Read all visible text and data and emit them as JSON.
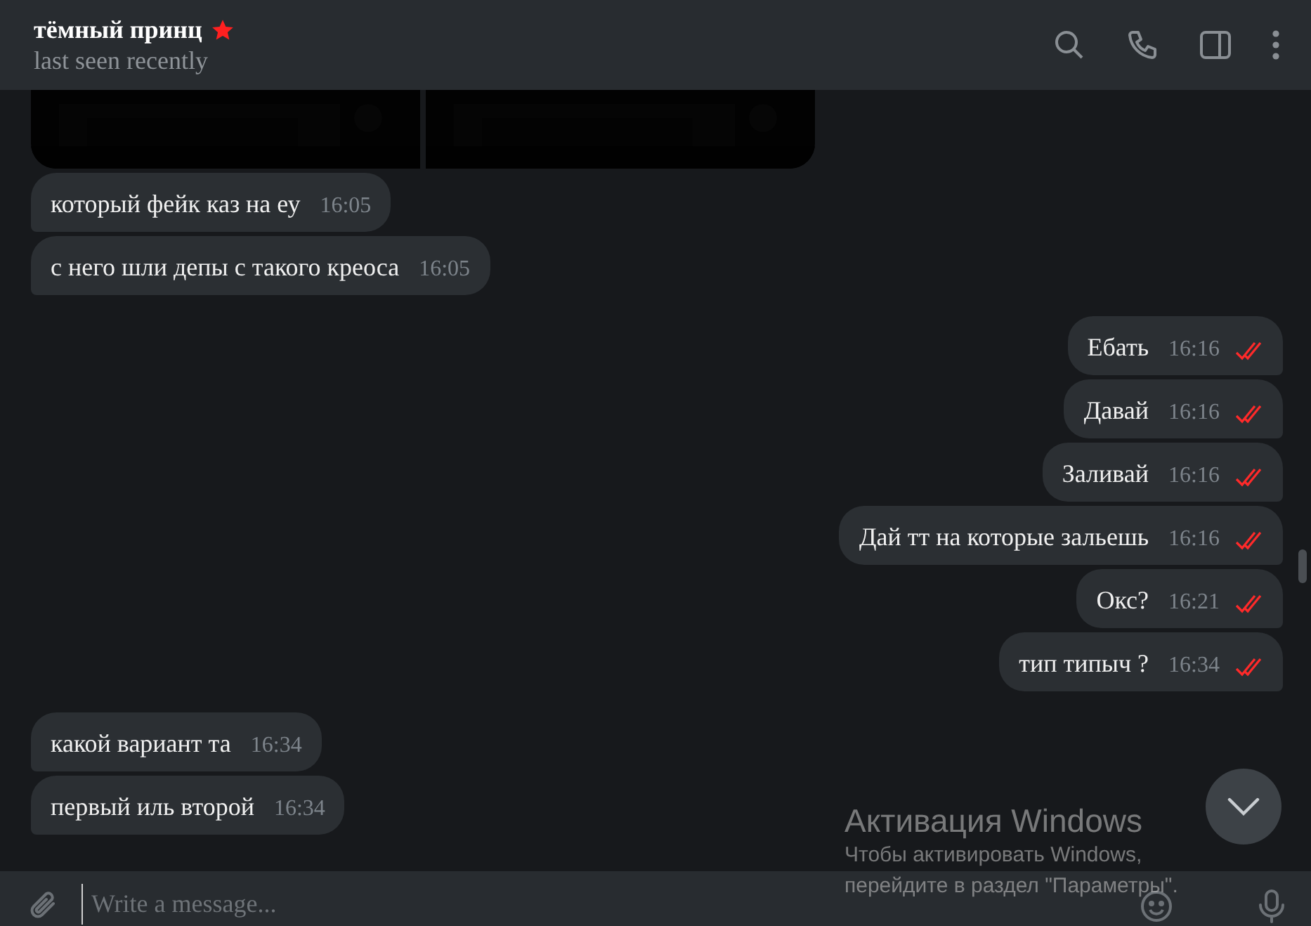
{
  "header": {
    "name": "тёмный принц",
    "verified_star": true,
    "status": "last seen recently"
  },
  "messages": [
    {
      "kind": "album"
    },
    {
      "kind": "incoming",
      "text": "который фейк каз на еу",
      "time": "16:05"
    },
    {
      "kind": "incoming",
      "text": "с него шли депы с такого креоса",
      "time": "16:05"
    },
    {
      "kind": "outgoing",
      "text": "Ебать",
      "time": "16:16",
      "read": true
    },
    {
      "kind": "outgoing",
      "text": "Давай",
      "time": "16:16",
      "read": true
    },
    {
      "kind": "outgoing",
      "text": "Заливай",
      "time": "16:16",
      "read": true
    },
    {
      "kind": "outgoing",
      "text": "Дай тт на которые зальешь",
      "time": "16:16",
      "read": true
    },
    {
      "kind": "outgoing",
      "text": "Окс?",
      "time": "16:21",
      "read": true
    },
    {
      "kind": "outgoing",
      "text": "тип типыч ?",
      "time": "16:34",
      "read": true
    },
    {
      "kind": "incoming",
      "text": "какой вариант та",
      "time": "16:34"
    },
    {
      "kind": "incoming",
      "text": "первый иль второй",
      "time": "16:34"
    }
  ],
  "composer": {
    "placeholder": "Write a message..."
  },
  "activation_notice": {
    "title": "Активация Windows",
    "lines": [
      "Чтобы активировать Windows,",
      "перейдите в раздел \"Параметры\"."
    ]
  }
}
